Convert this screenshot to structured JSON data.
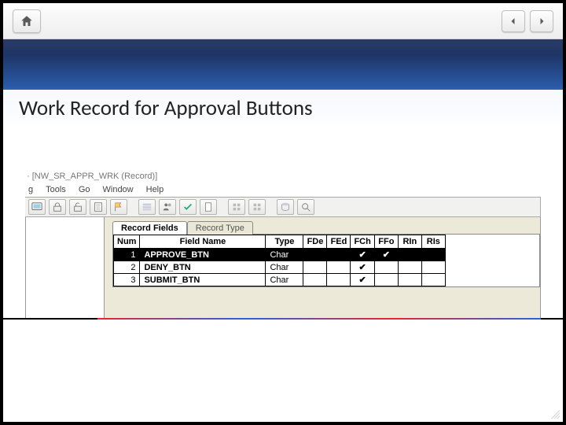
{
  "topnav": {
    "home_title": "Home",
    "prev_title": "Previous",
    "next_title": "Next"
  },
  "slide": {
    "title": "Work Record for Approval Buttons"
  },
  "designer": {
    "window_caption": "· [NW_SR_APPR_WRK (Record)]",
    "menu": {
      "debug_trunc": "g",
      "tools": "Tools",
      "go": "Go",
      "window": "Window",
      "help": "Help"
    },
    "tabs": {
      "fields": "Record Fields",
      "type": "Record Type"
    },
    "columns": {
      "num": "Num",
      "field_name": "Field Name",
      "type": "Type",
      "fde": "FDe",
      "fed": "FEd",
      "fch": "FCh",
      "ffo": "FFo",
      "rin": "RIn",
      "ris": "RIs"
    },
    "rows": [
      {
        "num": "1",
        "field_name": "APPROVE_BTN",
        "type": "Char",
        "fde": "",
        "fed": "",
        "fch": "✔",
        "ffo": "✔",
        "rin": "",
        "ris": "",
        "selected": true
      },
      {
        "num": "2",
        "field_name": "DENY_BTN",
        "type": "Char",
        "fde": "",
        "fed": "",
        "fch": "✔",
        "ffo": "",
        "rin": "",
        "ris": "",
        "selected": false
      },
      {
        "num": "3",
        "field_name": "SUBMIT_BTN",
        "type": "Char",
        "fde": "",
        "fed": "",
        "fch": "✔",
        "ffo": "",
        "rin": "",
        "ris": "",
        "selected": false
      }
    ]
  }
}
